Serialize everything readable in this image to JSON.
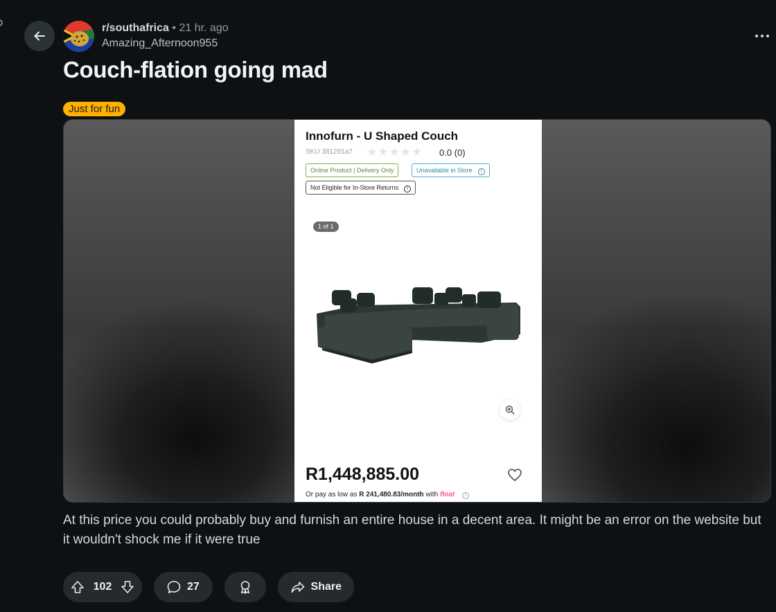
{
  "post": {
    "subreddit": "r/southafrica",
    "separator": "•",
    "time_ago": "21 hr. ago",
    "author": "Amazing_Afternoon955",
    "title": "Couch-flation going mad",
    "flair": "Just for fun",
    "flair_color": "#ffb000",
    "body": "At this price you could probably buy and furnish an entire house in a decent area. It might be an error on the website but it wouldn't shock me if it were true"
  },
  "product": {
    "name": "Innofurn - U Shaped Couch",
    "sku": "SKU 381291a7",
    "rating_text": "0.0 (0)",
    "stars": "★★★★★",
    "tags": {
      "online": "Online Product | Delivery Only",
      "unavailable": "Unavailable in Store",
      "returns": "Not Eligible for In-Store Returns"
    },
    "image_counter": "1 of 1",
    "price": "R1,448,885.00",
    "installment_prefix": "Or pay as low as",
    "installment_amount": "R 241,480.83/month",
    "installment_with": "with",
    "installment_brand": "float",
    "brand_color": "#ff4fa0"
  },
  "actions": {
    "votes": "102",
    "comments": "27",
    "share": "Share"
  },
  "icons": {
    "back": "arrow-left-icon",
    "more": "more-horizontal-icon",
    "upvote": "arrow-up-icon",
    "downvote": "arrow-down-icon",
    "comment": "speech-bubble-icon",
    "award": "award-ribbon-icon",
    "share": "share-arrow-icon",
    "zoom": "zoom-in-icon",
    "wishlist": "heart-icon"
  }
}
